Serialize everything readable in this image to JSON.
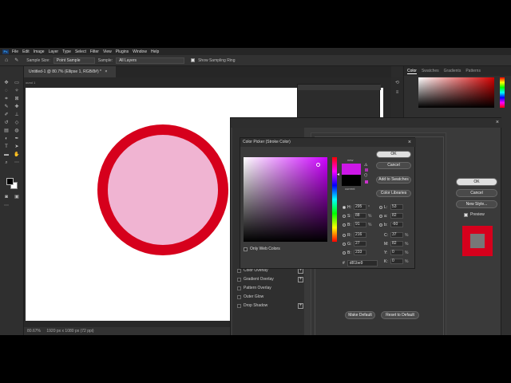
{
  "menu": {
    "logo": "Ps",
    "items": [
      "File",
      "Edit",
      "Image",
      "Layer",
      "Type",
      "Select",
      "Filter",
      "View",
      "Plugins",
      "Window",
      "Help"
    ]
  },
  "options": {
    "sample_size_label": "Sample Size:",
    "sample_size_value": "Point Sample",
    "sample_label": "Sample:",
    "sample_value": "All Layers",
    "show_ring_label": "Show Sampling Ring"
  },
  "document": {
    "tab_title": "Untitled-1 @ 80.7% (Ellipse 1, RGB/8#) *",
    "close": "×",
    "ruler_label": "ound 1"
  },
  "status": {
    "zoom": "80.67%",
    "size": "1920 px x 1080 px (72 ppi)"
  },
  "panels": {
    "tabs": [
      "Color",
      "Swatches",
      "Gradients",
      "Patterns"
    ]
  },
  "layer_style": {
    "style_items": [
      {
        "label": "Color Overlay",
        "plus": true
      },
      {
        "label": "Gradient Overlay",
        "plus": true
      },
      {
        "label": "Pattern Overlay",
        "plus": false
      },
      {
        "label": "Outer Glow",
        "plus": false
      },
      {
        "label": "Drop Shadow",
        "plus": true
      }
    ],
    "make_default": "Make Default",
    "reset_default": "Reset to Default",
    "ok": "OK",
    "cancel": "Cancel",
    "new_style": "New Style...",
    "preview": "Preview",
    "fx": "fx"
  },
  "color_picker": {
    "title": "Color Picker (Stroke Color)",
    "close": "×",
    "new_label": "new",
    "current_label": "current",
    "ok": "OK",
    "cancel": "Cancel",
    "add_swatches": "Add to Swatches",
    "color_libraries": "Color Libraries",
    "only_web": "Only Web Colors",
    "new_color": "#cc17e6",
    "current_color": "#000000",
    "hsb": [
      {
        "label": "H:",
        "value": "295",
        "unit": "°",
        "on": true
      },
      {
        "label": "S:",
        "value": "88",
        "unit": "%",
        "on": false
      },
      {
        "label": "B:",
        "value": "91",
        "unit": "%",
        "on": false
      }
    ],
    "rgb": [
      {
        "label": "R:",
        "value": "216",
        "on": false
      },
      {
        "label": "G:",
        "value": "27",
        "on": false
      },
      {
        "label": "B:",
        "value": "233",
        "on": false
      }
    ],
    "lab": [
      {
        "label": "L:",
        "value": "53",
        "on": false
      },
      {
        "label": "a:",
        "value": "82",
        "on": false
      },
      {
        "label": "b:",
        "value": "-60",
        "on": false
      }
    ],
    "cmyk": [
      {
        "label": "C:",
        "value": "37",
        "unit": "%"
      },
      {
        "label": "M:",
        "value": "82",
        "unit": "%"
      },
      {
        "label": "Y:",
        "value": "0",
        "unit": "%"
      },
      {
        "label": "K:",
        "value": "0",
        "unit": "%"
      }
    ],
    "hex_label": "#",
    "hex": "d81be9"
  },
  "colors": {
    "stroke": "#d6001c",
    "fill": "#f0b4d2"
  }
}
